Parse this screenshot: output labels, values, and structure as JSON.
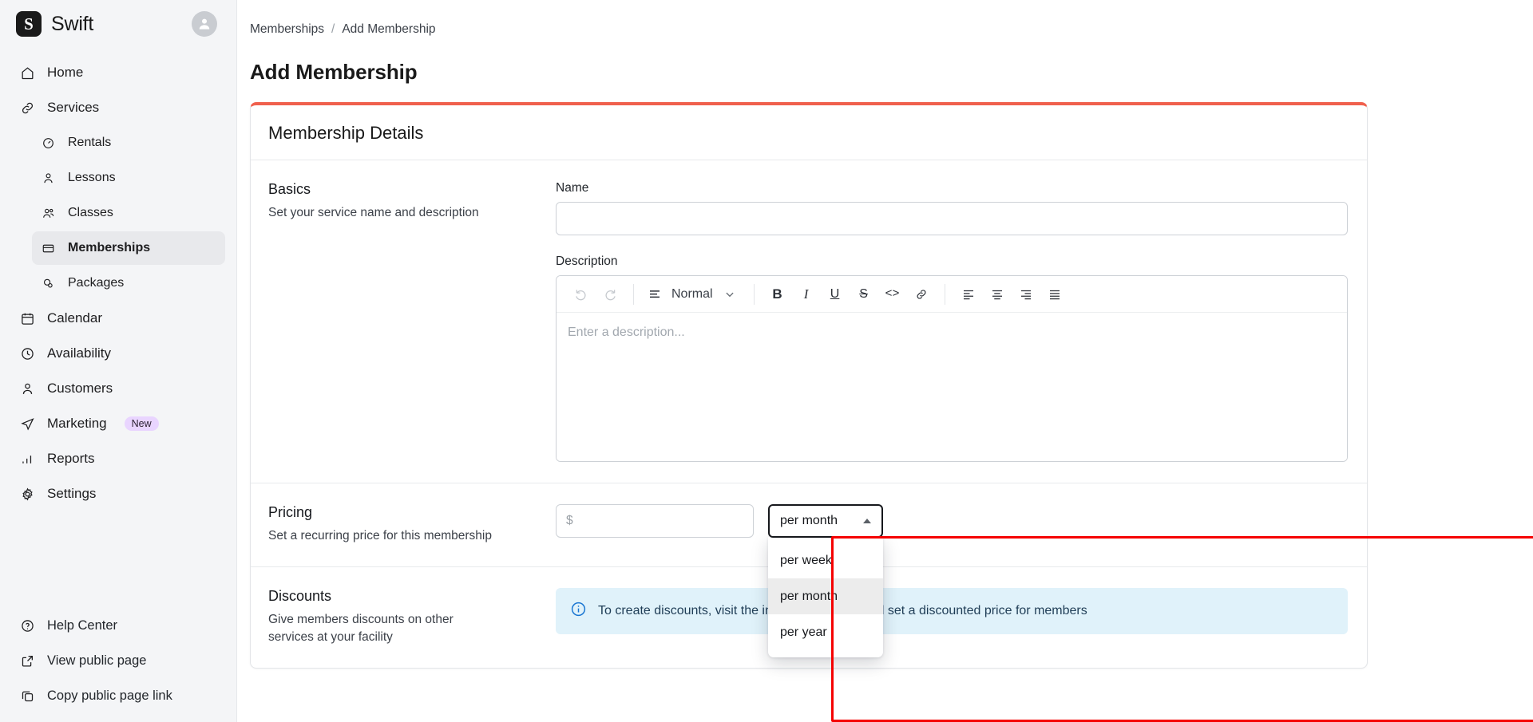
{
  "brand": {
    "mark": "S",
    "name": "Swift",
    "avatar_icon": "user-avatar-icon"
  },
  "sidebar": {
    "items": [
      {
        "label": "Home",
        "icon": "home-icon",
        "level": 0,
        "active": false
      },
      {
        "label": "Services",
        "icon": "link-icon",
        "level": 0,
        "active": false
      },
      {
        "label": "Rentals",
        "icon": "gauge-icon",
        "level": 1,
        "active": false
      },
      {
        "label": "Lessons",
        "icon": "person-icon",
        "level": 1,
        "active": false
      },
      {
        "label": "Classes",
        "icon": "people-icon",
        "level": 1,
        "active": false
      },
      {
        "label": "Memberships",
        "icon": "card-icon",
        "level": 1,
        "active": true
      },
      {
        "label": "Packages",
        "icon": "coins-icon",
        "level": 1,
        "active": false
      },
      {
        "label": "Calendar",
        "icon": "calendar-icon",
        "level": 0,
        "active": false
      },
      {
        "label": "Availability",
        "icon": "clock-icon",
        "level": 0,
        "active": false
      },
      {
        "label": "Customers",
        "icon": "person-icon",
        "level": 0,
        "active": false
      },
      {
        "label": "Marketing",
        "icon": "send-icon",
        "level": 0,
        "active": false,
        "badge": "New"
      },
      {
        "label": "Reports",
        "icon": "bar-chart-icon",
        "level": 0,
        "active": false
      },
      {
        "label": "Settings",
        "icon": "gear-icon",
        "level": 0,
        "active": false
      }
    ],
    "bottom_items": [
      {
        "label": "Help Center",
        "icon": "question-circle-icon"
      },
      {
        "label": "View public page",
        "icon": "external-link-icon"
      },
      {
        "label": "Copy public page link",
        "icon": "copy-icon"
      }
    ]
  },
  "breadcrumb": {
    "parent": "Memberships",
    "separator": "/",
    "current": "Add Membership"
  },
  "page": {
    "title": "Add Membership"
  },
  "card": {
    "title": "Membership Details",
    "accent_color": "#f0604d",
    "basics": {
      "title": "Basics",
      "subtitle": "Set your service name and description",
      "name_label": "Name",
      "name_value": "",
      "name_placeholder": "",
      "description_label": "Description",
      "description_placeholder": "Enter a description..."
    },
    "editor_toolbar": {
      "undo": "undo-icon",
      "redo": "redo-icon",
      "style_label": "Normal",
      "style_icon": "paragraph-icon",
      "chevron": "chevron-down-icon",
      "bold": "B",
      "italic": "I",
      "underline": "U",
      "strikethrough": "S",
      "code": "<>",
      "link": "link-icon",
      "align_left": "align-left-icon",
      "align_center": "align-center-icon",
      "align_right": "align-right-icon",
      "align_justify": "align-justify-icon"
    },
    "pricing": {
      "title": "Pricing",
      "subtitle": "Set a recurring price for this membership",
      "price_placeholder": "$",
      "price_value": "",
      "interval_selected": "per month",
      "interval_open": true,
      "interval_options": [
        "per week",
        "per month",
        "per year"
      ]
    },
    "discounts": {
      "title": "Discounts",
      "subtitle": "Give members discounts on other services at your facility",
      "info_text": "To create discounts, visit the individual service and set a discounted price for members",
      "info_icon": "info-circle-icon",
      "info_bg": "#e0f2fa"
    }
  },
  "annotation": {
    "color": "#f50000"
  }
}
